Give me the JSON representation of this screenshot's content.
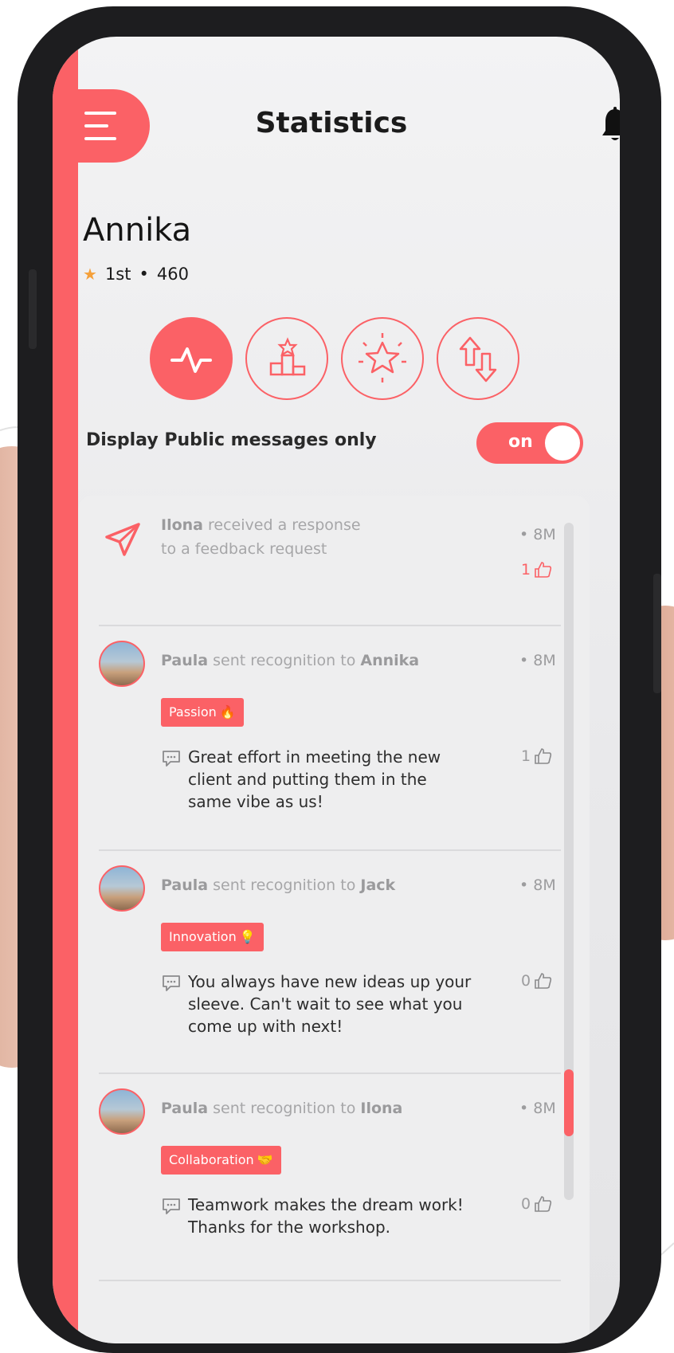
{
  "header": {
    "title": "Statistics"
  },
  "user": {
    "name": "Annika",
    "rank": "1st",
    "dot": "•",
    "points": "460"
  },
  "toggle": {
    "label": "Display Public messages only",
    "state": "on"
  },
  "colors": {
    "accent": "#fb6166",
    "text": "#1b1b1b",
    "muted": "#a6a6a8",
    "star": "#f5a03a"
  },
  "icons": [
    "menu-icon",
    "bell-icon",
    "activity-icon",
    "podium-icon",
    "star-burst-icon",
    "swap-arrows-icon",
    "paper-plane-icon",
    "comment-icon",
    "thumbs-up-icon"
  ],
  "feed": [
    {
      "actor": "Ilona",
      "action": "received a response",
      "action2": "to a feedback request",
      "time": "• 8M",
      "likes": "1"
    },
    {
      "actor": "Paula",
      "action": "sent recognition to",
      "target": "Annika",
      "time": "• 8M",
      "tag": "Passion",
      "tag_emoji": "🔥",
      "comment": "Great effort in meeting the new client and putting them in the same vibe as us!",
      "likes": "1"
    },
    {
      "actor": "Paula",
      "action": "sent recognition to",
      "target": "Jack",
      "time": "• 8M",
      "tag": "Innovation",
      "tag_emoji": "💡",
      "comment": "You always have new ideas up your sleeve. Can't wait to see what you come up with next!",
      "likes": "0"
    },
    {
      "actor": "Paula",
      "action": "sent recognition to",
      "target": "Ilona",
      "time": "• 8M",
      "tag": "Collaboration",
      "tag_emoji": "🤝",
      "comment": "Teamwork makes the dream work! Thanks for the workshop.",
      "likes": "0"
    }
  ]
}
